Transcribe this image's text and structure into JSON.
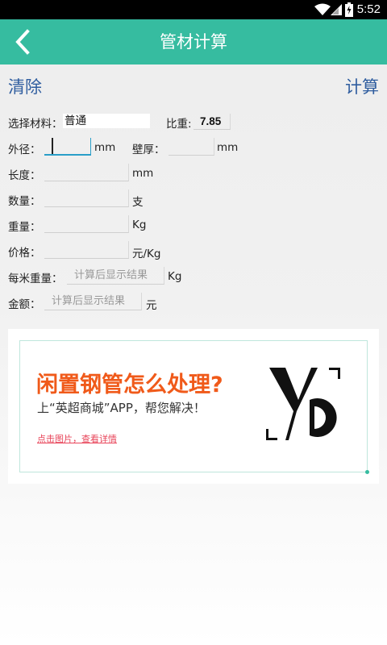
{
  "status_bar": {
    "time": "5:52",
    "icons": [
      "wifi-icon",
      "signal-icon",
      "battery-icon"
    ]
  },
  "app_bar": {
    "title": "管材计算",
    "back_icon": "back-arrow-icon",
    "color": "#36bca0"
  },
  "actions": {
    "clear": "清除",
    "calculate": "计算",
    "color": "#2f5d9f"
  },
  "form": {
    "material": {
      "label": "选择材料：",
      "value": "普通"
    },
    "density": {
      "label": "比重:",
      "value": "7.85"
    },
    "outer_diameter": {
      "label": "外径：",
      "value": "",
      "unit": "mm"
    },
    "wall_thickness": {
      "label": "壁厚：",
      "value": "",
      "unit": "mm"
    },
    "length": {
      "label": "长度：",
      "value": "",
      "unit": "mm"
    },
    "quantity": {
      "label": "数量：",
      "value": "",
      "unit": "支"
    },
    "weight": {
      "label": "重量：",
      "value": "",
      "unit": "Kg"
    },
    "price": {
      "label": "价格：",
      "value": "",
      "unit": "元/Kg"
    },
    "weight_per_meter": {
      "label": "每米重量：",
      "placeholder": "计算后显示结果",
      "unit": "Kg"
    },
    "amount": {
      "label": "金额：",
      "placeholder": "计算后显示结果",
      "unit": "元"
    }
  },
  "ad": {
    "headline": "闲置钢管怎么处理?",
    "subline": "上“英超商城”APP，帮您解决！",
    "link": "点击图片，查看详情",
    "headline_color": "#f05a1a",
    "link_color": "#e8455a"
  }
}
